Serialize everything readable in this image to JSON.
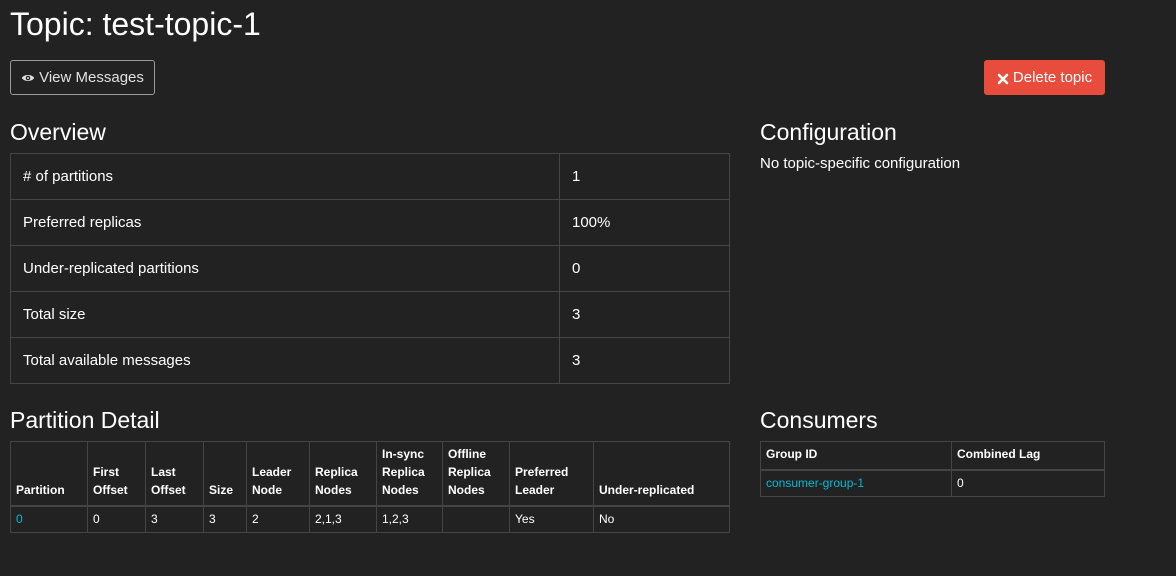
{
  "page": {
    "title": "Topic: test-topic-1"
  },
  "buttons": {
    "view_messages": "View Messages",
    "delete_topic": "Delete topic"
  },
  "overview": {
    "title": "Overview",
    "rows": [
      {
        "label": "# of partitions",
        "value": "1"
      },
      {
        "label": "Preferred replicas",
        "value": "100%"
      },
      {
        "label": "Under-replicated partitions",
        "value": "0"
      },
      {
        "label": "Total size",
        "value": "3"
      },
      {
        "label": "Total available messages",
        "value": "3"
      }
    ]
  },
  "configuration": {
    "title": "Configuration",
    "text": "No topic-specific configuration"
  },
  "partition_detail": {
    "title": "Partition Detail",
    "headers": {
      "partition": "Partition",
      "first_offset": "First Offset",
      "last_offset": "Last Offset",
      "size": "Size",
      "leader_node": "Leader Node",
      "replica_nodes": "Replica Nodes",
      "insync_replica_nodes": "In-sync Replica Nodes",
      "offline_replica_nodes": "Offline Replica Nodes",
      "preferred_leader": "Preferred Leader",
      "under_replicated": "Under-replicated"
    },
    "rows": [
      {
        "partition": "0",
        "first_offset": "0",
        "last_offset": "3",
        "size": "3",
        "leader_node": "2",
        "replica_nodes": "2,1,3",
        "insync_replica_nodes": "1,2,3",
        "offline_replica_nodes": "",
        "preferred_leader": "Yes",
        "under_replicated": "No"
      }
    ]
  },
  "consumers": {
    "title": "Consumers",
    "headers": {
      "group_id": "Group ID",
      "combined_lag": "Combined Lag"
    },
    "rows": [
      {
        "group_id": "consumer-group-1",
        "combined_lag": "0"
      }
    ]
  },
  "colors": {
    "background": "#222222",
    "link": "#00bcd4",
    "danger": "#e74c3c",
    "border": "#464545"
  }
}
